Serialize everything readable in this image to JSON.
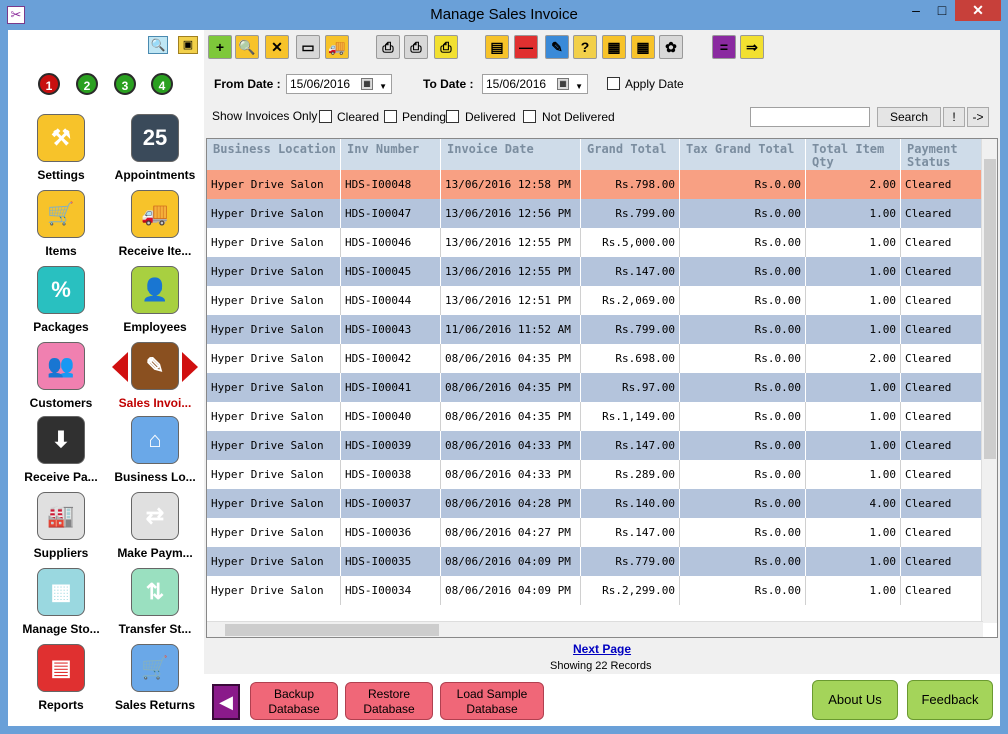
{
  "window": {
    "title": "Manage Sales Invoice",
    "min": "–",
    "max": "□",
    "close": "✕"
  },
  "sidebar": {
    "numbers": [
      "1",
      "2",
      "3",
      "4"
    ],
    "tiles": [
      {
        "label": "Settings",
        "color": "#f7c32a",
        "glyph": "⚒"
      },
      {
        "label": "Appointments",
        "color": "#3a4a5a",
        "glyph": "25"
      },
      {
        "label": "Items",
        "color": "#f7c32a",
        "glyph": "🛒"
      },
      {
        "label": "Receive Ite...",
        "color": "#f7c32a",
        "glyph": "🚚"
      },
      {
        "label": "Packages",
        "color": "#29c0c0",
        "glyph": "%"
      },
      {
        "label": "Employees",
        "color": "#a8d040",
        "glyph": "👤"
      },
      {
        "label": "Customers",
        "color": "#f080b0",
        "glyph": "👥"
      },
      {
        "label": "Sales Invoi...",
        "color": "#8a5020",
        "glyph": "✎"
      },
      {
        "label": "Receive Pa...",
        "color": "#303030",
        "glyph": "⬇"
      },
      {
        "label": "Business Lo...",
        "color": "#6aa8e8",
        "glyph": "⌂"
      },
      {
        "label": "Suppliers",
        "color": "#e0e0e0",
        "glyph": "🏭"
      },
      {
        "label": "Make Paym...",
        "color": "#e0e0e0",
        "glyph": "⇄"
      },
      {
        "label": "Manage Sto...",
        "color": "#9ad8e0",
        "glyph": "▦"
      },
      {
        "label": "Transfer St...",
        "color": "#9ae0c0",
        "glyph": "⇅"
      },
      {
        "label": "Reports",
        "color": "#e03030",
        "glyph": "▤"
      },
      {
        "label": "Sales Returns",
        "color": "#6aa8e8",
        "glyph": "🛒"
      }
    ]
  },
  "toolbar": {
    "icons": [
      "+",
      "🔍",
      "✕",
      "▭",
      "🚚",
      "⎙",
      "⎙",
      "⎙",
      "▤",
      "—",
      "✎",
      "?",
      "▦",
      "▦",
      "✿",
      "=",
      "⇒"
    ]
  },
  "filters": {
    "from_label": "From Date :",
    "from_value": "15/06/2016",
    "to_label": "To Date :",
    "to_value": "15/06/2016",
    "apply_date": "Apply Date",
    "show_only": "Show Invoices Only :",
    "cleared": "Cleared",
    "pending": "Pending",
    "delivered": "Delivered",
    "not_delivered": "Not Delivered",
    "search_button": "Search",
    "bang": "!",
    "arrow": "->"
  },
  "grid": {
    "columns": [
      "Business Location",
      "Inv Number",
      "Invoice Date",
      "Grand Total",
      "Tax Grand Total",
      "Total Item Qty",
      "Payment Status"
    ],
    "rows": [
      [
        "Hyper Drive Salon",
        "HDS-I00048",
        "13/06/2016 12:58 PM",
        "Rs.798.00",
        "Rs.0.00",
        "2.00",
        "Cleared"
      ],
      [
        "Hyper Drive Salon",
        "HDS-I00047",
        "13/06/2016 12:56 PM",
        "Rs.799.00",
        "Rs.0.00",
        "1.00",
        "Cleared"
      ],
      [
        "Hyper Drive Salon",
        "HDS-I00046",
        "13/06/2016 12:55 PM",
        "Rs.5,000.00",
        "Rs.0.00",
        "1.00",
        "Cleared"
      ],
      [
        "Hyper Drive Salon",
        "HDS-I00045",
        "13/06/2016 12:55 PM",
        "Rs.147.00",
        "Rs.0.00",
        "1.00",
        "Cleared"
      ],
      [
        "Hyper Drive Salon",
        "HDS-I00044",
        "13/06/2016 12:51 PM",
        "Rs.2,069.00",
        "Rs.0.00",
        "1.00",
        "Cleared"
      ],
      [
        "Hyper Drive Salon",
        "HDS-I00043",
        "11/06/2016 11:52 AM",
        "Rs.799.00",
        "Rs.0.00",
        "1.00",
        "Cleared"
      ],
      [
        "Hyper Drive Salon",
        "HDS-I00042",
        "08/06/2016 04:35 PM",
        "Rs.698.00",
        "Rs.0.00",
        "2.00",
        "Cleared"
      ],
      [
        "Hyper Drive Salon",
        "HDS-I00041",
        "08/06/2016 04:35 PM",
        "Rs.97.00",
        "Rs.0.00",
        "1.00",
        "Cleared"
      ],
      [
        "Hyper Drive Salon",
        "HDS-I00040",
        "08/06/2016 04:35 PM",
        "Rs.1,149.00",
        "Rs.0.00",
        "1.00",
        "Cleared"
      ],
      [
        "Hyper Drive Salon",
        "HDS-I00039",
        "08/06/2016 04:33 PM",
        "Rs.147.00",
        "Rs.0.00",
        "1.00",
        "Cleared"
      ],
      [
        "Hyper Drive Salon",
        "HDS-I00038",
        "08/06/2016 04:33 PM",
        "Rs.289.00",
        "Rs.0.00",
        "1.00",
        "Cleared"
      ],
      [
        "Hyper Drive Salon",
        "HDS-I00037",
        "08/06/2016 04:28 PM",
        "Rs.140.00",
        "Rs.0.00",
        "4.00",
        "Cleared"
      ],
      [
        "Hyper Drive Salon",
        "HDS-I00036",
        "08/06/2016 04:27 PM",
        "Rs.147.00",
        "Rs.0.00",
        "1.00",
        "Cleared"
      ],
      [
        "Hyper Drive Salon",
        "HDS-I00035",
        "08/06/2016 04:09 PM",
        "Rs.779.00",
        "Rs.0.00",
        "1.00",
        "Cleared"
      ],
      [
        "Hyper Drive Salon",
        "HDS-I00034",
        "08/06/2016 04:09 PM",
        "Rs.2,299.00",
        "Rs.0.00",
        "1.00",
        "Cleared"
      ]
    ]
  },
  "footer": {
    "next_page": "Next Page",
    "showing": "Showing 22 Records",
    "backup": "Backup Database",
    "restore": "Restore Database",
    "load_sample": "Load Sample Database",
    "about": "About Us",
    "feedback": "Feedback"
  }
}
